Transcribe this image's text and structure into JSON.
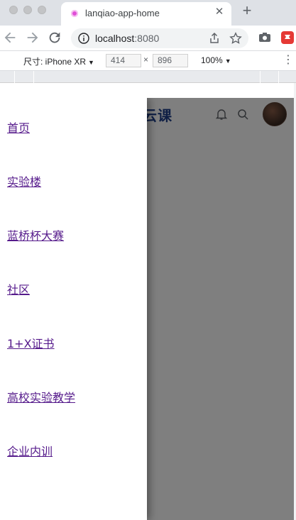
{
  "browser": {
    "tab_title": "lanqiao-app-home",
    "tab_close": "✕",
    "new_tab": "+",
    "url_host": "localhost",
    "url_port": ":8080"
  },
  "devtools": {
    "device_label": "尺寸: iPhone XR",
    "width": "414",
    "height": "896",
    "zoom": "100%",
    "dimension_separator": "×",
    "caret": "▼",
    "more": "⋮"
  },
  "app": {
    "brand_visible_text": "桥云课"
  },
  "drawer": {
    "items": [
      {
        "label": "首页"
      },
      {
        "label": "实验楼"
      },
      {
        "label": "蓝桥杯大赛"
      },
      {
        "label": "社区"
      },
      {
        "label": "1+X证书"
      },
      {
        "label": "高校实验教学"
      },
      {
        "label": "企业内训"
      }
    ]
  },
  "colors": {
    "brand": "#1e3f8a",
    "link_visited": "#551a8b",
    "overlay": "rgba(0,0,0,0.5)"
  }
}
